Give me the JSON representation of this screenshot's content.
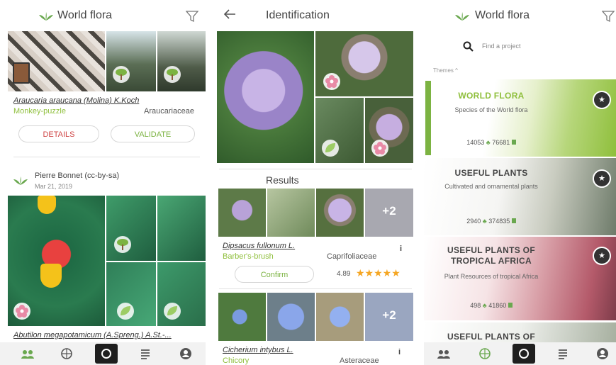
{
  "panel1": {
    "title": "World flora",
    "obs1": {
      "latin": "Araucaria araucana (Molina) K.Koch",
      "common": "Monkey-puzzle",
      "family": "Araucariaceae",
      "details_label": "DETAILS",
      "validate_label": "VALIDATE"
    },
    "obs2": {
      "author": "Pierre Bonnet (cc-by-sa)",
      "date": "Mar 21, 2019",
      "latin": "Abutilon megapotamicum (A.Spreng.) A.St.-..."
    }
  },
  "panel2": {
    "title": "Identification",
    "results_label": "Results",
    "result1": {
      "latin": "Dipsacus fullonum L.",
      "common": "Barber's-brush",
      "family": "Caprifoliaceae",
      "confirm_label": "Confirm",
      "score": "4.89",
      "more": "+2",
      "stars": "★★★★★"
    },
    "result2": {
      "latin": "Cicherium intybus L.",
      "common": "Chicory",
      "family": "Asteraceae",
      "more": "+2"
    },
    "info_glyph": "i"
  },
  "panel3": {
    "title": "World flora",
    "search_placeholder": "Find a project",
    "themes_label": "Themes ^",
    "themes": [
      {
        "title": "WORLD FLORA",
        "sub": "Species of the World flora",
        "obs": "14053",
        "img": "76681"
      },
      {
        "title": "USEFUL PLANTS",
        "sub": "Cultivated and ornamental plants",
        "obs": "2940",
        "img": "374835"
      },
      {
        "title": "USEFUL PLANTS OF TROPICAL AFRICA",
        "sub": "Plant Resources of tropical Africa",
        "obs": "498",
        "img": "41860"
      },
      {
        "title": "USEFUL PLANTS OF"
      }
    ]
  },
  "colors": {
    "accent_green": "#8fbf3c",
    "validate_green": "#7cb342",
    "details_red": "#d04848",
    "star_yellow": "#f5a623"
  }
}
